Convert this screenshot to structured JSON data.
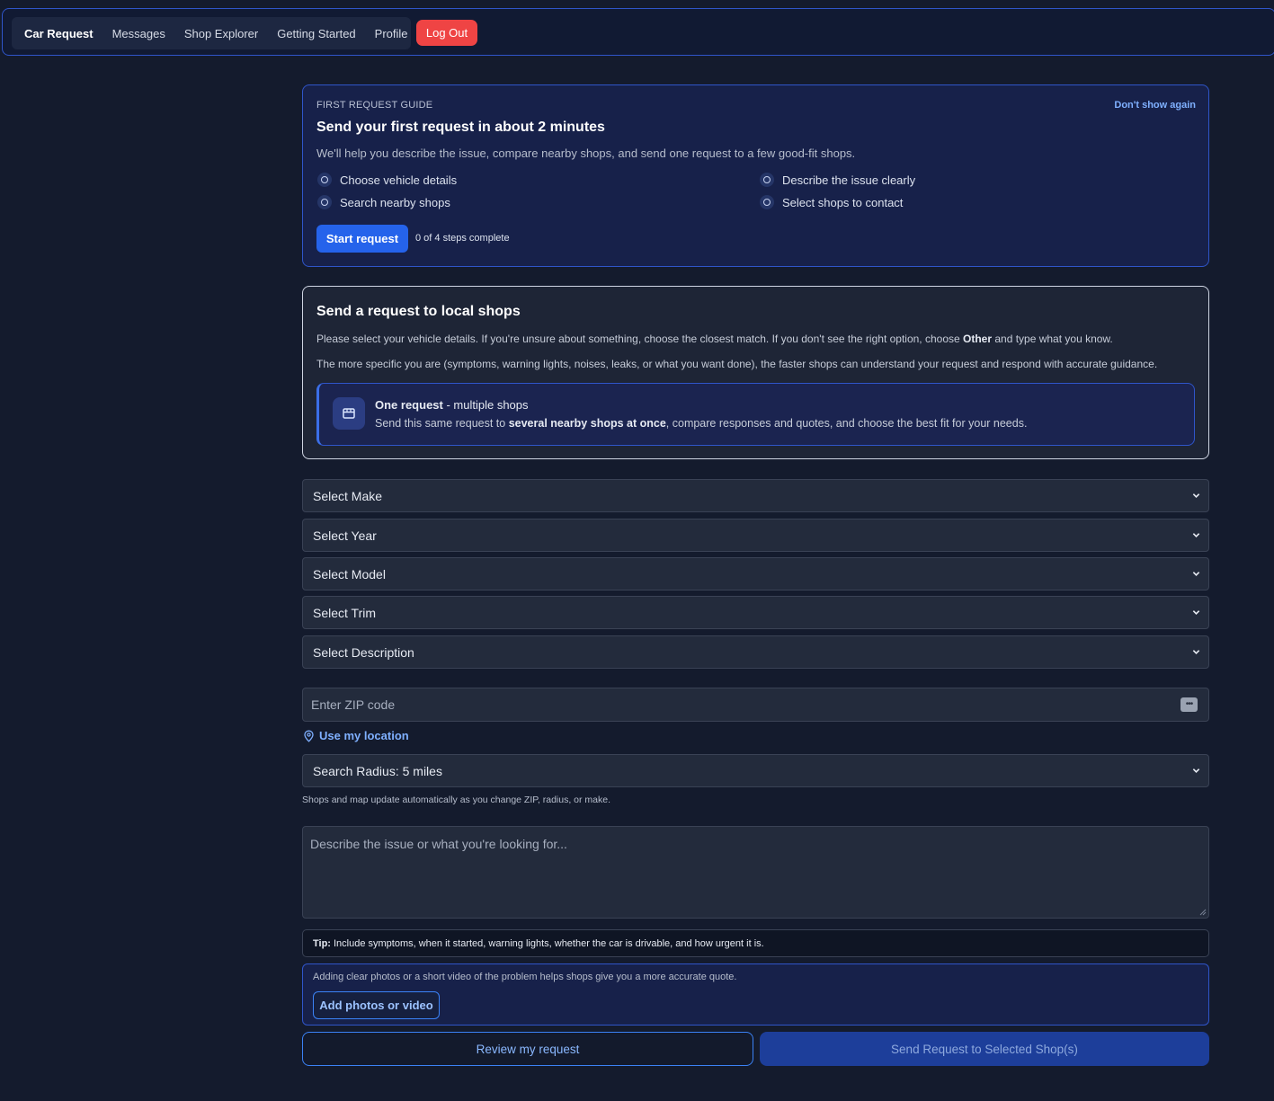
{
  "nav": {
    "items": [
      "Car Request",
      "Messages",
      "Shop Explorer",
      "Getting Started",
      "Profile"
    ],
    "logout": "Log Out"
  },
  "guide": {
    "eyebrow": "FIRST REQUEST GUIDE",
    "dismiss": "Don't show again",
    "title": "Send your first request in about 2 minutes",
    "subtitle": "We'll help you describe the issue, compare nearby shops, and send one request to a few good-fit shops.",
    "steps": [
      "Choose vehicle details",
      "Describe the issue clearly",
      "Search nearby shops",
      "Select shops to contact"
    ],
    "start_button": "Start request",
    "progress": "0 of 4 steps complete"
  },
  "request": {
    "title": "Send a request to local shops",
    "p1_before": "Please select your vehicle details. If you're unsure about something, choose the closest match. If you don't see the right option, choose ",
    "p1_bold": "Other",
    "p1_after": " and type what you know.",
    "p2": "The more specific you are (symptoms, warning lights, noises, leaks, or what you want done), the faster shops can understand your request and respond with accurate guidance.",
    "info_title_bold": "One request",
    "info_title_rest": " - multiple shops",
    "info_before": "Send this same request to ",
    "info_bold": "several nearby shops at once",
    "info_after": ", compare responses and quotes, and choose the best fit for your needs."
  },
  "form": {
    "make": "Select Make",
    "year": "Select Year",
    "model": "Select Model",
    "trim": "Select Trim",
    "description": "Select Description",
    "zip_placeholder": "Enter ZIP code",
    "use_location": "Use my location",
    "radius": "Search Radius: 5 miles",
    "radius_hint": "Shops and map update automatically as you change ZIP, radius, or make.",
    "issue_placeholder": "Describe the issue or what you're looking for...",
    "tip_label": "Tip:",
    "tip_text": "Include symptoms, when it started, warning lights, whether the car is drivable, and how urgent it is.",
    "media_text": "Adding clear photos or a short video of the problem helps shops give you a more accurate quote.",
    "media_button": "Add photos or video",
    "review_button": "Review my request",
    "send_button": "Send Request to Selected Shop(s)"
  },
  "colors": {
    "accent": "#2563eb",
    "danger": "#ef4444",
    "background": "#141b2d"
  }
}
